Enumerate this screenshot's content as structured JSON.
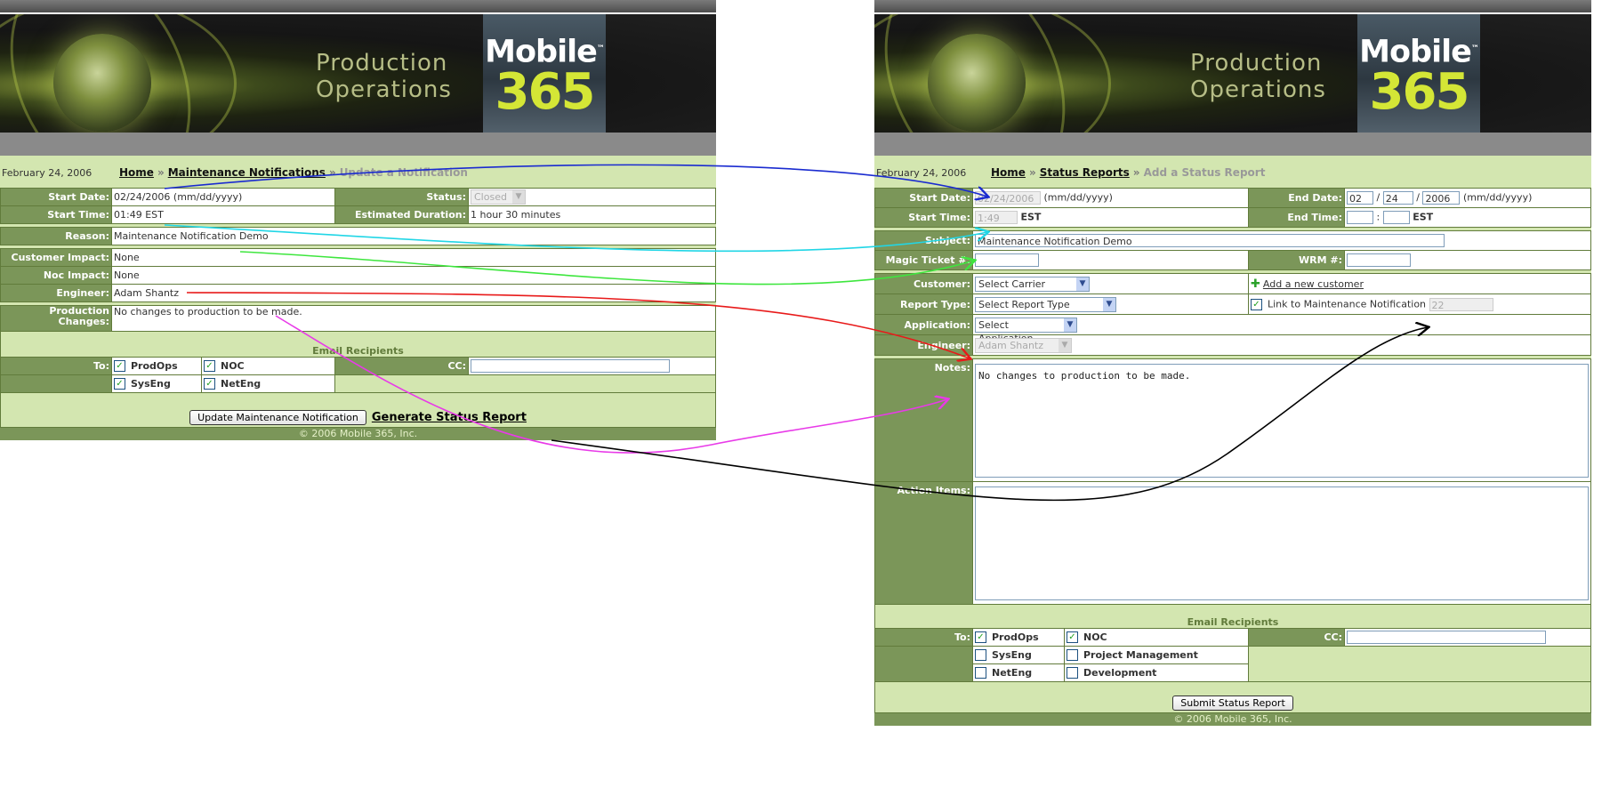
{
  "brand": {
    "title_line1": "Production",
    "title_line2": "Operations",
    "logo_word": "Mobile",
    "logo_tm": "™",
    "logo_number": "365"
  },
  "left": {
    "date": "February 24, 2006",
    "breadcrumb": {
      "home": "Home",
      "sep": "»",
      "section": "Maintenance Notifications",
      "current": "Update a Notification"
    },
    "fields": {
      "start_date_label": "Start Date:",
      "start_date_value": "02/24/2006 (mm/dd/yyyy)",
      "status_label": "Status:",
      "status_value": "Closed",
      "start_time_label": "Start Time:",
      "start_time_value": "01:49 EST",
      "duration_label": "Estimated Duration:",
      "duration_value": "1 hour 30 minutes",
      "reason_label": "Reason:",
      "reason_value": "Maintenance Notification Demo",
      "customer_impact_label": "Customer Impact:",
      "customer_impact_value": "None",
      "noc_impact_label": "Noc Impact:",
      "noc_impact_value": "None",
      "engineer_label": "Engineer:",
      "engineer_value": "Adam Shantz",
      "prod_changes_label": "Production Changes:",
      "prod_changes_value": "No changes to production to be made."
    },
    "email": {
      "heading": "Email Recipients",
      "to_label": "To:",
      "cc_label": "CC:",
      "recipients": [
        {
          "label": "ProdOps",
          "checked": true
        },
        {
          "label": "NOC",
          "checked": true
        },
        {
          "label": "SysEng",
          "checked": true
        },
        {
          "label": "NetEng",
          "checked": true
        }
      ]
    },
    "update_button": "Update Maintenance Notification",
    "generate_link": "Generate Status Report",
    "footer": "© 2006 Mobile 365, Inc."
  },
  "right": {
    "date": "February 24, 2006",
    "breadcrumb": {
      "home": "Home",
      "sep": "»",
      "section": "Status Reports",
      "current": "Add a Status Report"
    },
    "fields": {
      "start_date_label": "Start Date:",
      "start_date_value": "02/24/2006",
      "date_format": "(mm/dd/yyyy)",
      "end_date_label": "End Date:",
      "end_month": "02",
      "end_day": "24",
      "end_year": "2006",
      "slash": "/",
      "start_time_label": "Start Time:",
      "start_time_value": "1:49",
      "tz": "EST",
      "end_time_label": "End Time:",
      "colon": ":",
      "subject_label": "Subject:",
      "subject_value": "Maintenance Notification Demo",
      "magic_ticket_label": "Magic Ticket #:",
      "wrm_label": "WRM #:",
      "customer_label": "Customer:",
      "customer_select": "Select Carrier",
      "add_customer": "Add a new customer",
      "report_type_label": "Report Type:",
      "report_type_select": "Select Report Type",
      "link_label": "Link to Maintenance Notification",
      "link_value": "22",
      "application_label": "Application:",
      "application_select": "Select Application",
      "engineer_label": "Engineer:",
      "engineer_select": "Adam Shantz",
      "notes_label": "Notes:",
      "notes_value": "No changes to production to be made.",
      "action_items_label": "Action Items:"
    },
    "email": {
      "heading": "Email Recipients",
      "to_label": "To:",
      "cc_label": "CC:",
      "recipients": [
        {
          "label": "ProdOps",
          "checked": true
        },
        {
          "label": "NOC",
          "checked": true
        },
        {
          "label": "SysEng",
          "checked": false
        },
        {
          "label": "Project Management",
          "checked": false
        },
        {
          "label": "NetEng",
          "checked": false
        },
        {
          "label": "Development",
          "checked": false
        }
      ]
    },
    "submit_button": "Submit Status Report",
    "footer": "© 2006 Mobile 365, Inc."
  },
  "colors": {
    "arrow_blue": "#1a2bd0",
    "arrow_cyan": "#21d6e6",
    "arrow_green": "#3ee63e",
    "arrow_red": "#e81a1a",
    "arrow_magenta": "#e83ae8",
    "arrow_black": "#000000"
  }
}
